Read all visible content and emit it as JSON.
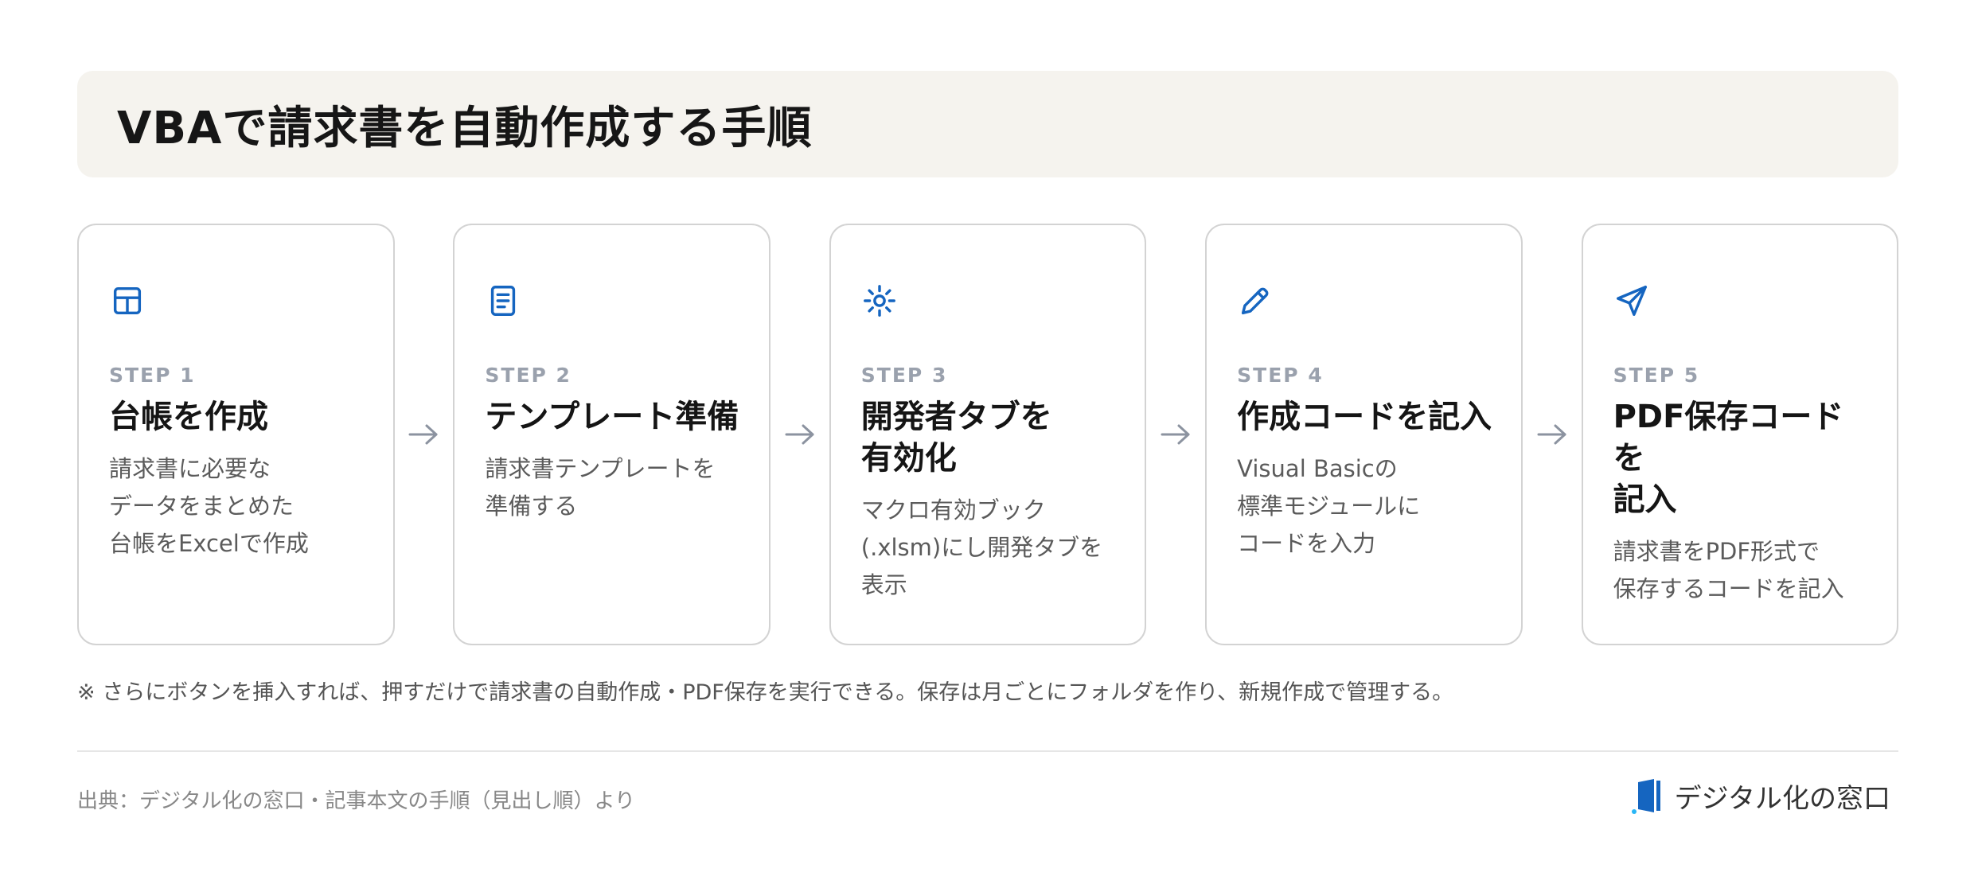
{
  "title": "VBAで請求書を自動作成する手順",
  "accent_color": "#1565c0",
  "steps": [
    {
      "icon": "table-icon",
      "label": "STEP 1",
      "heading": "台帳を作成",
      "description": "請求書に必要な\nデータをまとめた\n台帳をExcelで作成"
    },
    {
      "icon": "document-icon",
      "label": "STEP 2",
      "heading": "テンプレート準備",
      "description": "請求書テンプレートを\n準備する"
    },
    {
      "icon": "gear-icon",
      "label": "STEP 3",
      "heading": "開発者タブを\n有効化",
      "description": "マクロ有効ブック\n(.xlsm)にし開発タブを\n表示"
    },
    {
      "icon": "pencil-icon",
      "label": "STEP 4",
      "heading": "作成コードを記入",
      "description": "Visual Basicの\n標準モジュールに\nコードを入力"
    },
    {
      "icon": "send-icon",
      "label": "STEP 5",
      "heading": "PDF保存コードを\n記入",
      "description": "請求書をPDF形式で\n保存するコードを記入"
    }
  ],
  "note": "※ さらにボタンを挿入すれば、押すだけで請求書の自動作成・PDF保存を実行できる。保存は月ごとにフォルダを作り、新規作成で管理する。",
  "source": "出典：デジタル化の窓口・記事本文の手順（見出し順）より",
  "brand": {
    "logo_icon": "brand-logo-icon",
    "name": "デジタル化の窓口"
  }
}
